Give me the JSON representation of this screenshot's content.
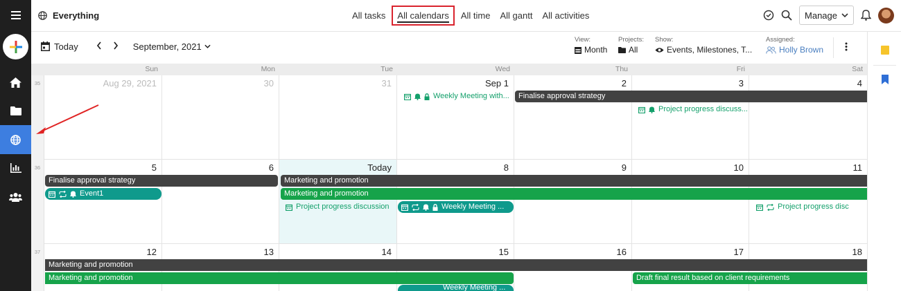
{
  "app": {
    "workspace": "Everything",
    "nav_tabs": [
      "All tasks",
      "All calendars",
      "All time",
      "All gantt",
      "All activities"
    ],
    "active_tab": "All calendars",
    "manage_label": "Manage"
  },
  "toolbar": {
    "today_label": "Today",
    "month_label": "September, 2021",
    "view": {
      "label": "View:",
      "value": "Month"
    },
    "projects": {
      "label": "Projects:",
      "value": "All"
    },
    "show": {
      "label": "Show:",
      "value": "Events, Milestones, T..."
    },
    "assigned": {
      "label": "Assigned:",
      "value": "Holly Brown"
    }
  },
  "calendar": {
    "weekdays": [
      "Sun",
      "Mon",
      "Tue",
      "Wed",
      "Thu",
      "Fri",
      "Sat"
    ],
    "weeks": [
      {
        "number": "35",
        "days": [
          "Aug 29, 2021",
          "30",
          "31",
          "Sep 1",
          "2",
          "3",
          "4"
        ]
      },
      {
        "number": "36",
        "days": [
          "5",
          "6",
          "Today",
          "8",
          "9",
          "10",
          "11"
        ]
      },
      {
        "number": "37",
        "days": [
          "12",
          "13",
          "14",
          "15",
          "16",
          "17",
          "18"
        ]
      }
    ],
    "events": {
      "w1_weekly": "Weekly Meeting with...",
      "w1_finalise": "Finalise approval strategy",
      "w1_progress": "Project progress discuss...",
      "w2_finalise": "Finalise approval strategy",
      "w2_marketing_dark": "Marketing and promotion",
      "w2_event1": "Event1",
      "w2_marketing_green": "Marketing and promotion",
      "w2_progress": "Project progress discussion",
      "w2_weekly": "Weekly Meeting ...",
      "w2_progress_sat": "Project progress disc",
      "w3_marketing_dark": "Marketing and promotion",
      "w3_marketing_green": "Marketing and promotion",
      "w3_weekly": "Weekly Meeting ...",
      "w3_draft": "Draft final result based on client requirements"
    }
  },
  "colors": {
    "rail": "#1f1f1f",
    "rail_active": "#3d7ee0",
    "event_dark": "#424242",
    "event_green": "#16a34a",
    "event_teal": "#0f9a8c",
    "annotation_red": "#e02424",
    "today_bg": "#e9f7f8"
  }
}
